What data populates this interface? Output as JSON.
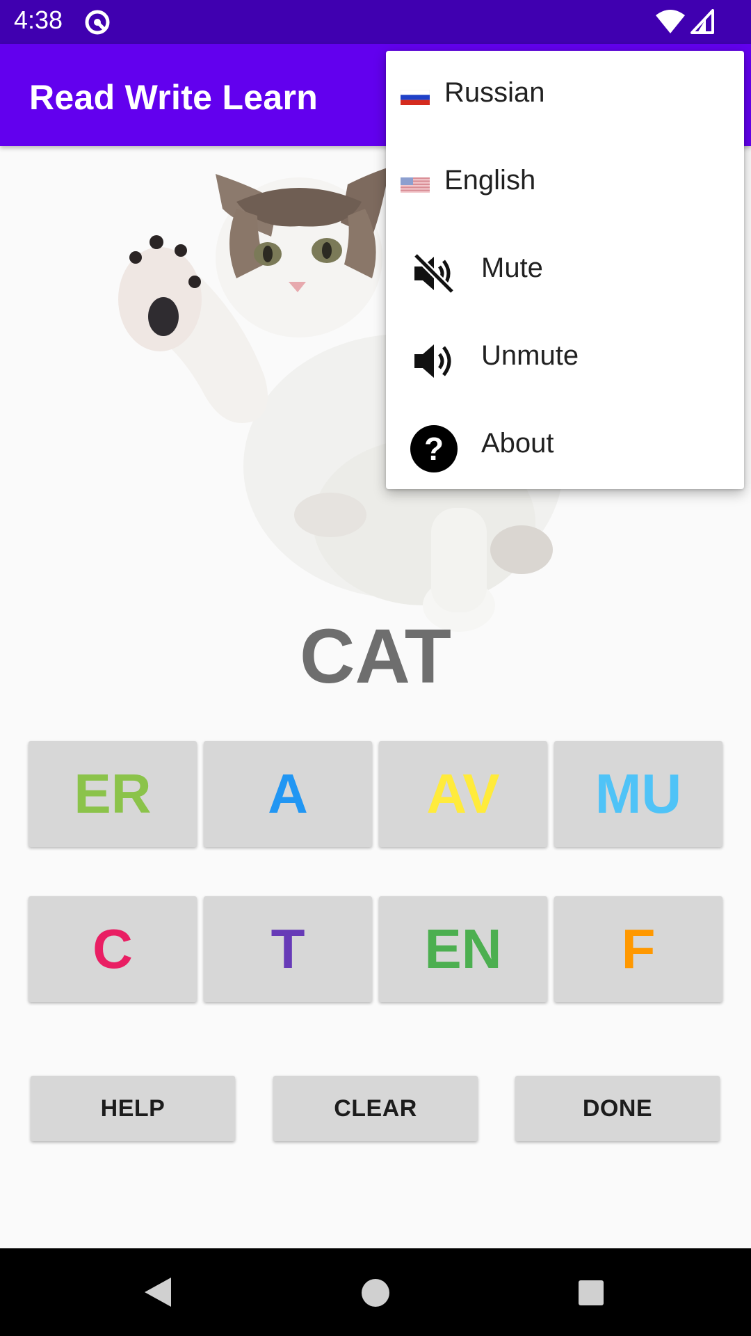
{
  "status_bar": {
    "time": "4:38",
    "app_icon": "circle-slash-icon",
    "wifi_icon": "wifi-icon",
    "cell_icon": "cell-signal-icon"
  },
  "app_bar": {
    "title": "Read Write Learn",
    "color": "#6200EE"
  },
  "content": {
    "image": "cat-waving-image",
    "word": "CAT"
  },
  "letter_tiles": [
    {
      "label": "ER",
      "color": "#8BC34A"
    },
    {
      "label": "A",
      "color": "#2196F3"
    },
    {
      "label": "AV",
      "color": "#FFEB3B"
    },
    {
      "label": "MU",
      "color": "#4FC3F7"
    },
    {
      "label": "C",
      "color": "#E91E63"
    },
    {
      "label": "T",
      "color": "#673AB7"
    },
    {
      "label": "EN",
      "color": "#4CAF50"
    },
    {
      "label": "F",
      "color": "#FF9800"
    }
  ],
  "actions": {
    "help_label": "HELP",
    "clear_label": "CLEAR",
    "done_label": "DONE"
  },
  "menu": {
    "items": [
      {
        "label": "Russian",
        "icon": "russian-flag-icon"
      },
      {
        "label": "English",
        "icon": "us-flag-icon"
      },
      {
        "label": "Mute",
        "icon": "volume-off-icon"
      },
      {
        "label": "Unmute",
        "icon": "volume-up-icon"
      },
      {
        "label": "About",
        "icon": "help-circle-icon"
      }
    ]
  },
  "nav_bar": {
    "back_icon": "back-triangle-icon",
    "home_icon": "home-circle-icon",
    "recents_icon": "recents-square-icon"
  }
}
